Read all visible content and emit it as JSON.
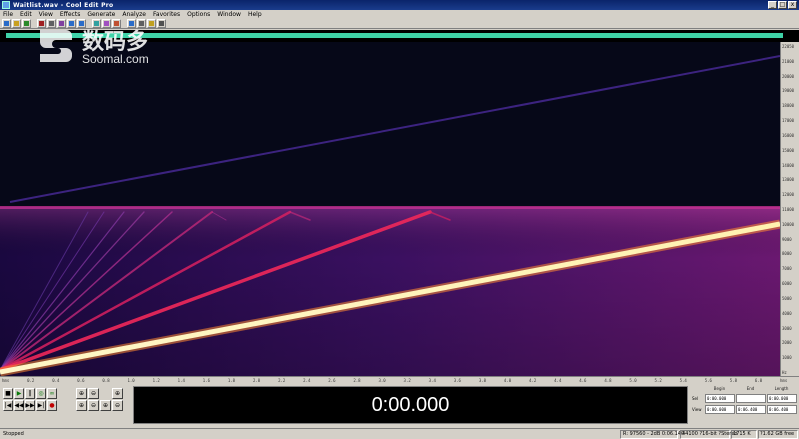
{
  "window": {
    "title": "Waitlist.wav - Cool Edit Pro",
    "minimize_label": "_",
    "maximize_label": "□",
    "close_label": "x"
  },
  "menu": [
    "File",
    "Edit",
    "View",
    "Effects",
    "Generate",
    "Analyze",
    "Favorites",
    "Options",
    "Window",
    "Help"
  ],
  "toolbar": {
    "buttons": [
      "new-file-icon",
      "open-file-icon",
      "save-icon",
      "cut-icon",
      "copy-icon",
      "paste-icon",
      "undo-icon",
      "redo-icon",
      "waveform-view-icon",
      "spectral-view-icon",
      "cue-icon",
      "marker-icon",
      "zoom-icon",
      "mix-icon",
      "settings-icon"
    ],
    "colors": {
      "accent": "#0a246a",
      "overview": "#3fd3a8"
    }
  },
  "frequency_ruler": [
    "22050",
    "21000",
    "20000",
    "19000",
    "18000",
    "17000",
    "16000",
    "15000",
    "14000",
    "13000",
    "12000",
    "11000",
    "10000",
    "9000",
    "8000",
    "7000",
    "6000",
    "5000",
    "4000",
    "3000",
    "2000",
    "1000",
    "Hz"
  ],
  "time_ruler": [
    "hms",
    "0.2",
    "0.4",
    "0.6",
    "0.8",
    "1.0",
    "1.2",
    "1.4",
    "1.6",
    "1.8",
    "2.0",
    "2.2",
    "2.4",
    "2.6",
    "2.8",
    "3.0",
    "3.2",
    "3.4",
    "3.6",
    "3.8",
    "4.0",
    "4.2",
    "4.4",
    "4.6",
    "4.8",
    "5.0",
    "5.2",
    "5.4",
    "5.6",
    "5.8",
    "6.0",
    "hms"
  ],
  "transport": {
    "buttons": [
      "■",
      "▶",
      "‖",
      "◎",
      "∞",
      "",
      "|◀",
      "◀◀",
      "▶▶",
      "▶|",
      "●",
      ""
    ]
  },
  "zoom_buttons": [
    "⊕",
    "⊖",
    "",
    "⊕",
    "⊕",
    "⊖",
    "⊕",
    "⊖"
  ],
  "time_display": "0:00.000",
  "selection_panel": {
    "headers": [
      "Begin",
      "End",
      "Length"
    ],
    "rows": [
      {
        "label": "Sel",
        "begin": "0:00.000",
        "length": "0:00.000"
      },
      {
        "label": "View",
        "begin": "0:00.000",
        "end": "0:06.400",
        "length": "0:06.400"
      }
    ]
  },
  "status": {
    "state": "Stopped",
    "cursor": "R: 97560 - 2dB  0:06.140",
    "format": "44100 ?16-bit ?Stereo",
    "size": "1715 K",
    "free": "?1.62 GB free"
  },
  "watermark": {
    "cn": "数码多",
    "en": "Soomal.com"
  }
}
